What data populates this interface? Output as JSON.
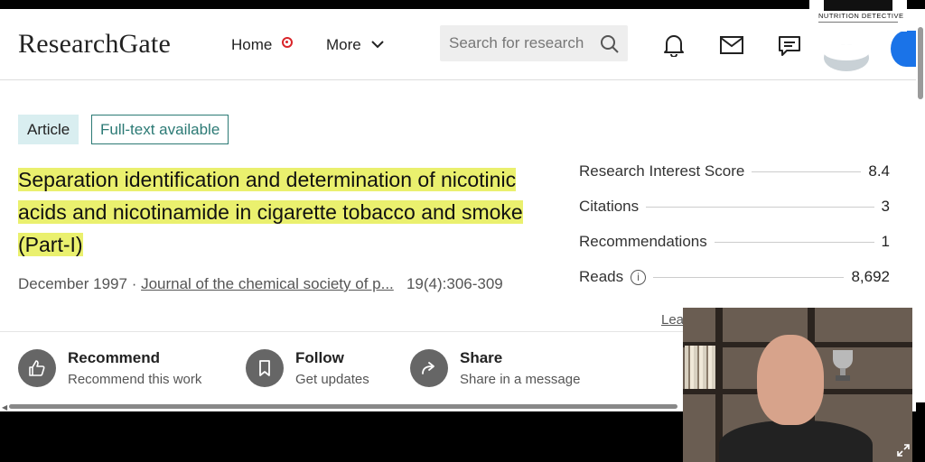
{
  "header": {
    "logo": "ResearchGate",
    "nav_home": "Home",
    "nav_more": "More",
    "search_placeholder": "Search for research",
    "overlay_logo_text": "NUTRITION DETECTIVE"
  },
  "article": {
    "badge_type": "Article",
    "badge_fulltext": "Full-text available",
    "title": "Separation identification and determination of nicotinic acids and nicotinamide in cigarette tobacco and smoke (Part-I)",
    "date": "December 1997",
    "journal": "Journal of the chemical society of p...",
    "volume_pages": "19(4):306-309"
  },
  "stats": [
    {
      "label": "Research Interest Score",
      "value": "8.4"
    },
    {
      "label": "Citations",
      "value": "3"
    },
    {
      "label": "Recommendations",
      "value": "1"
    },
    {
      "label": "Reads",
      "value": "8,692"
    }
  ],
  "stats_link": "Lea",
  "actions": [
    {
      "title": "Recommend",
      "subtitle": "Recommend this work",
      "icon": "thumbs-up-icon"
    },
    {
      "title": "Follow",
      "subtitle": "Get updates",
      "icon": "bookmark-icon"
    },
    {
      "title": "Share",
      "subtitle": "Share in a message",
      "icon": "share-arrow-icon"
    }
  ],
  "colors": {
    "highlight": "#eaf06e",
    "home_dot": "#d9252a",
    "teal": "#2c7a75",
    "article_badge_bg": "#d9eef0"
  }
}
